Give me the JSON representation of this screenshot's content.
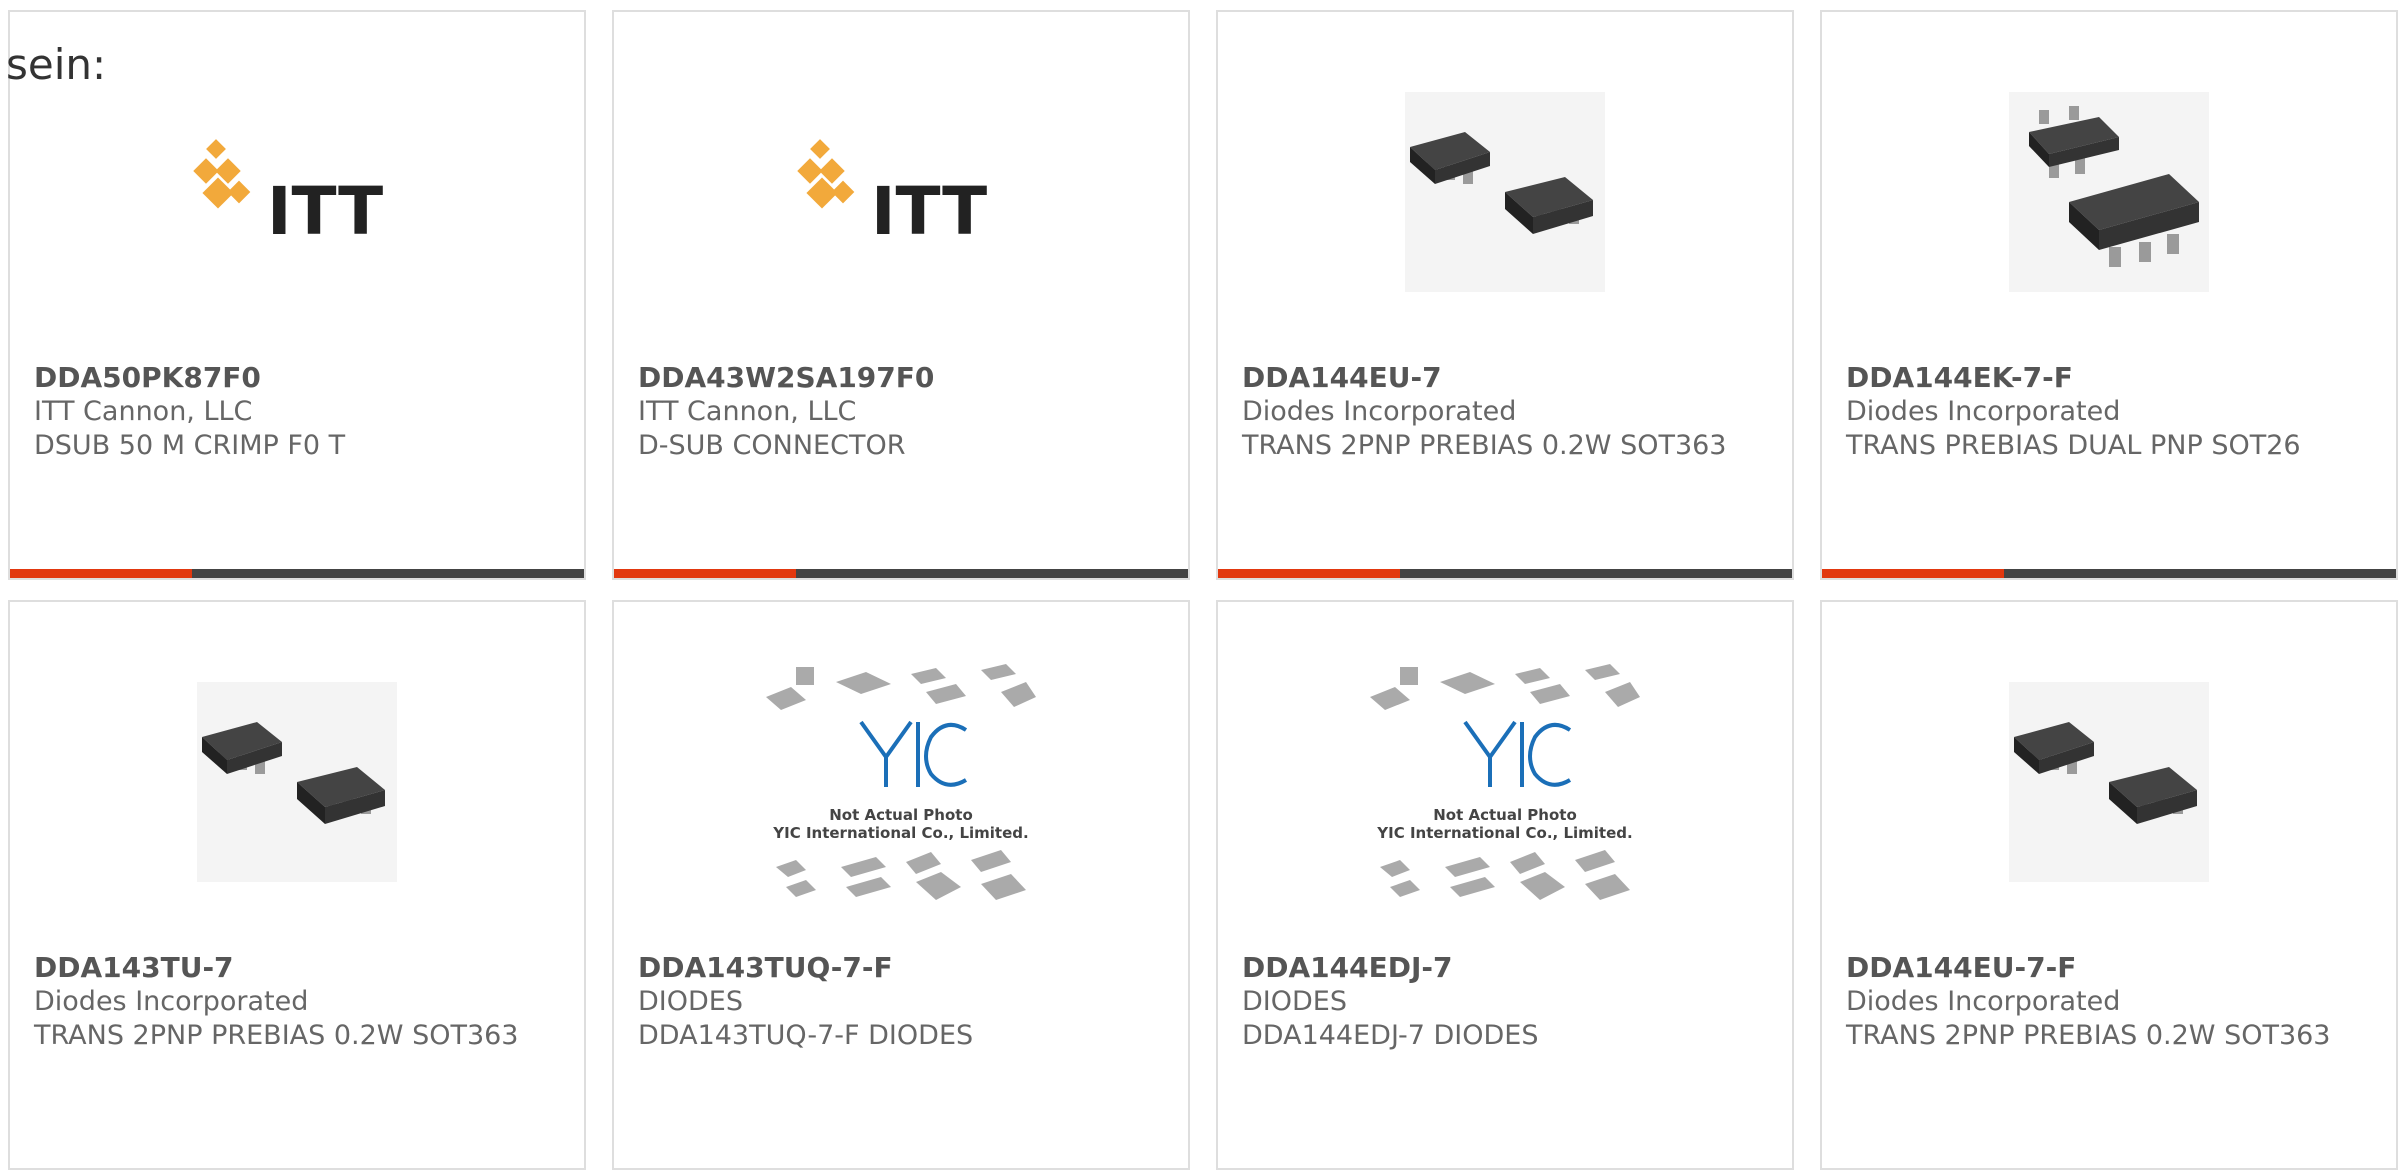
{
  "header_text": "sein:",
  "accent_color": "#e2380f",
  "bar_color": "#444444",
  "products": [
    {
      "mpn": "DDA50PK87F0",
      "manufacturer": "ITT Cannon, LLC",
      "description": "DSUB 50 M CRIMP F0 T",
      "image": "itt-logo",
      "logo_text": "ITT"
    },
    {
      "mpn": "DDA43W2SA197F0",
      "manufacturer": "ITT Cannon, LLC",
      "description": "D-SUB CONNECTOR",
      "image": "itt-logo",
      "logo_text": "ITT"
    },
    {
      "mpn": "DDA144EU-7",
      "manufacturer": "Diodes Incorporated",
      "description": "TRANS 2PNP PREBIAS 0.2W SOT363",
      "image": "sot363-chip"
    },
    {
      "mpn": "DDA144EK-7-F",
      "manufacturer": "Diodes Incorporated",
      "description": "TRANS PREBIAS DUAL PNP SOT26",
      "image": "sot26-chip"
    },
    {
      "mpn": "DDA143TU-7",
      "manufacturer": "Diodes Incorporated",
      "description": "TRANS 2PNP PREBIAS 0.2W SOT363",
      "image": "sot363-chip"
    },
    {
      "mpn": "DDA143TUQ-7-F",
      "manufacturer": "DIODES",
      "description": "DDA143TUQ-7-F DIODES",
      "image": "yic-placeholder",
      "placeholder_line1": "Not Actual Photo",
      "placeholder_line2": "YIC International Co., Limited."
    },
    {
      "mpn": "DDA144EDJ-7",
      "manufacturer": "DIODES",
      "description": "DDA144EDJ-7 DIODES",
      "image": "yic-placeholder",
      "placeholder_line1": "Not Actual Photo",
      "placeholder_line2": "YIC International Co., Limited."
    },
    {
      "mpn": "DDA144EU-7-F",
      "manufacturer": "Diodes Incorporated",
      "description": "TRANS 2PNP PREBIAS 0.2W SOT363",
      "image": "sot363-chip"
    }
  ]
}
